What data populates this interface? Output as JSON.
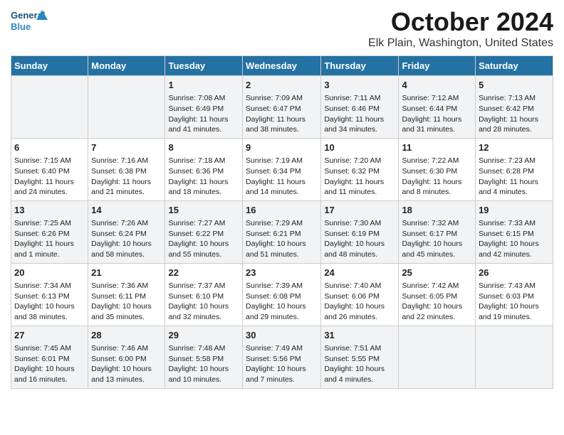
{
  "logo": {
    "text_general": "General",
    "text_blue": "Blue"
  },
  "title": "October 2024",
  "subtitle": "Elk Plain, Washington, United States",
  "days_of_week": [
    "Sunday",
    "Monday",
    "Tuesday",
    "Wednesday",
    "Thursday",
    "Friday",
    "Saturday"
  ],
  "weeks": [
    [
      {
        "date": "",
        "info": ""
      },
      {
        "date": "",
        "info": ""
      },
      {
        "date": "1",
        "info": "Sunrise: 7:08 AM\nSunset: 6:49 PM\nDaylight: 11 hours and 41 minutes."
      },
      {
        "date": "2",
        "info": "Sunrise: 7:09 AM\nSunset: 6:47 PM\nDaylight: 11 hours and 38 minutes."
      },
      {
        "date": "3",
        "info": "Sunrise: 7:11 AM\nSunset: 6:46 PM\nDaylight: 11 hours and 34 minutes."
      },
      {
        "date": "4",
        "info": "Sunrise: 7:12 AM\nSunset: 6:44 PM\nDaylight: 11 hours and 31 minutes."
      },
      {
        "date": "5",
        "info": "Sunrise: 7:13 AM\nSunset: 6:42 PM\nDaylight: 11 hours and 28 minutes."
      }
    ],
    [
      {
        "date": "6",
        "info": "Sunrise: 7:15 AM\nSunset: 6:40 PM\nDaylight: 11 hours and 24 minutes."
      },
      {
        "date": "7",
        "info": "Sunrise: 7:16 AM\nSunset: 6:38 PM\nDaylight: 11 hours and 21 minutes."
      },
      {
        "date": "8",
        "info": "Sunrise: 7:18 AM\nSunset: 6:36 PM\nDaylight: 11 hours and 18 minutes."
      },
      {
        "date": "9",
        "info": "Sunrise: 7:19 AM\nSunset: 6:34 PM\nDaylight: 11 hours and 14 minutes."
      },
      {
        "date": "10",
        "info": "Sunrise: 7:20 AM\nSunset: 6:32 PM\nDaylight: 11 hours and 11 minutes."
      },
      {
        "date": "11",
        "info": "Sunrise: 7:22 AM\nSunset: 6:30 PM\nDaylight: 11 hours and 8 minutes."
      },
      {
        "date": "12",
        "info": "Sunrise: 7:23 AM\nSunset: 6:28 PM\nDaylight: 11 hours and 4 minutes."
      }
    ],
    [
      {
        "date": "13",
        "info": "Sunrise: 7:25 AM\nSunset: 6:26 PM\nDaylight: 11 hours and 1 minute."
      },
      {
        "date": "14",
        "info": "Sunrise: 7:26 AM\nSunset: 6:24 PM\nDaylight: 10 hours and 58 minutes."
      },
      {
        "date": "15",
        "info": "Sunrise: 7:27 AM\nSunset: 6:22 PM\nDaylight: 10 hours and 55 minutes."
      },
      {
        "date": "16",
        "info": "Sunrise: 7:29 AM\nSunset: 6:21 PM\nDaylight: 10 hours and 51 minutes."
      },
      {
        "date": "17",
        "info": "Sunrise: 7:30 AM\nSunset: 6:19 PM\nDaylight: 10 hours and 48 minutes."
      },
      {
        "date": "18",
        "info": "Sunrise: 7:32 AM\nSunset: 6:17 PM\nDaylight: 10 hours and 45 minutes."
      },
      {
        "date": "19",
        "info": "Sunrise: 7:33 AM\nSunset: 6:15 PM\nDaylight: 10 hours and 42 minutes."
      }
    ],
    [
      {
        "date": "20",
        "info": "Sunrise: 7:34 AM\nSunset: 6:13 PM\nDaylight: 10 hours and 38 minutes."
      },
      {
        "date": "21",
        "info": "Sunrise: 7:36 AM\nSunset: 6:11 PM\nDaylight: 10 hours and 35 minutes."
      },
      {
        "date": "22",
        "info": "Sunrise: 7:37 AM\nSunset: 6:10 PM\nDaylight: 10 hours and 32 minutes."
      },
      {
        "date": "23",
        "info": "Sunrise: 7:39 AM\nSunset: 6:08 PM\nDaylight: 10 hours and 29 minutes."
      },
      {
        "date": "24",
        "info": "Sunrise: 7:40 AM\nSunset: 6:06 PM\nDaylight: 10 hours and 26 minutes."
      },
      {
        "date": "25",
        "info": "Sunrise: 7:42 AM\nSunset: 6:05 PM\nDaylight: 10 hours and 22 minutes."
      },
      {
        "date": "26",
        "info": "Sunrise: 7:43 AM\nSunset: 6:03 PM\nDaylight: 10 hours and 19 minutes."
      }
    ],
    [
      {
        "date": "27",
        "info": "Sunrise: 7:45 AM\nSunset: 6:01 PM\nDaylight: 10 hours and 16 minutes."
      },
      {
        "date": "28",
        "info": "Sunrise: 7:46 AM\nSunset: 6:00 PM\nDaylight: 10 hours and 13 minutes."
      },
      {
        "date": "29",
        "info": "Sunrise: 7:48 AM\nSunset: 5:58 PM\nDaylight: 10 hours and 10 minutes."
      },
      {
        "date": "30",
        "info": "Sunrise: 7:49 AM\nSunset: 5:56 PM\nDaylight: 10 hours and 7 minutes."
      },
      {
        "date": "31",
        "info": "Sunrise: 7:51 AM\nSunset: 5:55 PM\nDaylight: 10 hours and 4 minutes."
      },
      {
        "date": "",
        "info": ""
      },
      {
        "date": "",
        "info": ""
      }
    ]
  ]
}
